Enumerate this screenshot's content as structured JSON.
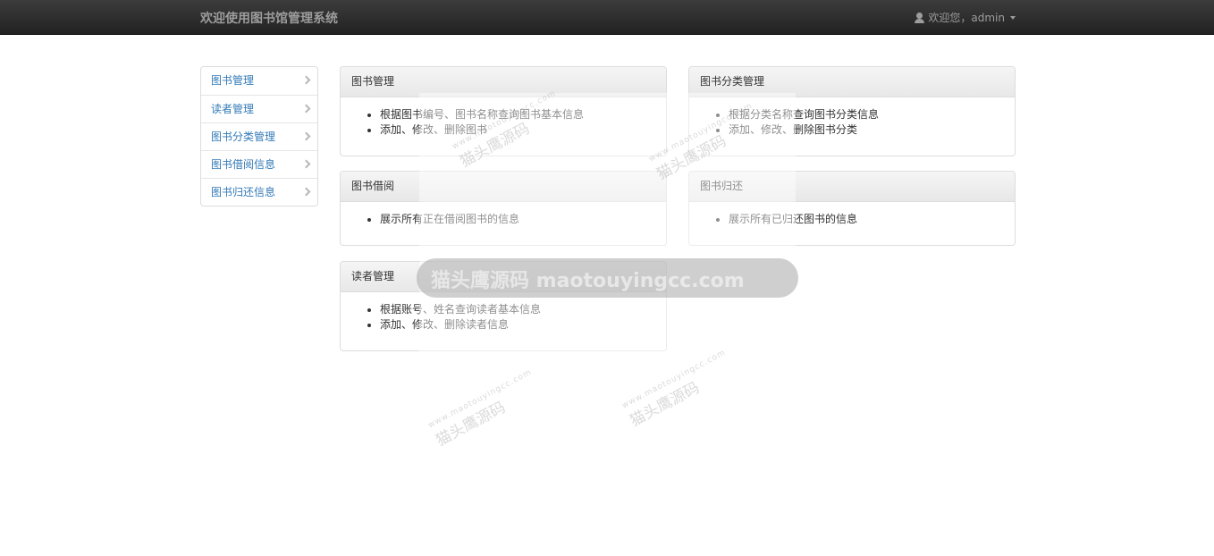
{
  "navbar": {
    "brand": "欢迎使用图书馆管理系统",
    "user_label": "欢迎您，admin"
  },
  "sidebar": {
    "items": [
      {
        "label": "图书管理",
        "icon": "chevron-right-icon"
      },
      {
        "label": "读者管理",
        "icon": "chevron-right-icon"
      },
      {
        "label": "图书分类管理",
        "icon": "chevron-right-icon"
      },
      {
        "label": "图书借阅信息",
        "icon": "chevron-right-icon"
      },
      {
        "label": "图书归还信息",
        "icon": "chevron-right-icon"
      }
    ]
  },
  "panels": {
    "book_mgmt": {
      "title": "图书管理",
      "items": [
        "根据图书编号、图书名称查询图书基本信息",
        "添加、修改、删除图书"
      ]
    },
    "category_mgmt": {
      "title": "图书分类管理",
      "items": [
        "根据分类名称查询图书分类信息",
        "添加、修改、删除图书分类"
      ]
    },
    "borrow": {
      "title": "图书借阅",
      "items": [
        "展示所有正在借阅图书的信息"
      ]
    },
    "return": {
      "title": "图书归还",
      "items": [
        "展示所有已归还图书的信息"
      ]
    },
    "reader_mgmt": {
      "title": "读者管理",
      "items": [
        "根据账号、姓名查询读者基本信息",
        "添加、修改、删除读者信息"
      ]
    }
  },
  "watermark": {
    "main": "猫头鹰源码 maotouyingcc.com",
    "stamp": "猫头鹰源码",
    "stamp_url": "www.maotouyingcc.com"
  }
}
